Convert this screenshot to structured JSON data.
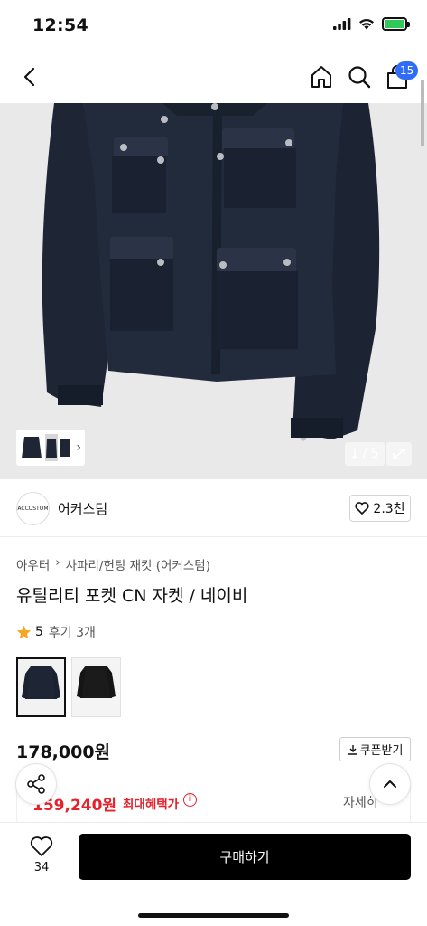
{
  "status_bar": {
    "time": "12:54"
  },
  "nav": {
    "cart_count": "15"
  },
  "gallery": {
    "counter": "1 / 5"
  },
  "brand": {
    "logo_text": "ACCUSTOM",
    "name": "어커스텀",
    "likes": "2.3천"
  },
  "breadcrumb": [
    "아우터",
    "사파리/헌팅 재킷 (어커스텀)"
  ],
  "product": {
    "title": "유틸리티 포켓 CN 자켓 / 네이비",
    "rating": "5",
    "reviews": "후기 3개",
    "price": "178,000원",
    "coupon_label": "쿠폰받기",
    "benefit_price": "159,240원",
    "benefit_label": "최대혜택가",
    "benefit_detail": "자세히"
  },
  "colors": {
    "jacket_navy": "#1e2636",
    "jacket_black": "#1b1b1b",
    "badge_blue": "#2f6df6",
    "sale_red": "#e8202a",
    "star_orange": "#f5a623"
  },
  "bottom": {
    "heart_count": "34",
    "buy_label": "구매하기"
  }
}
